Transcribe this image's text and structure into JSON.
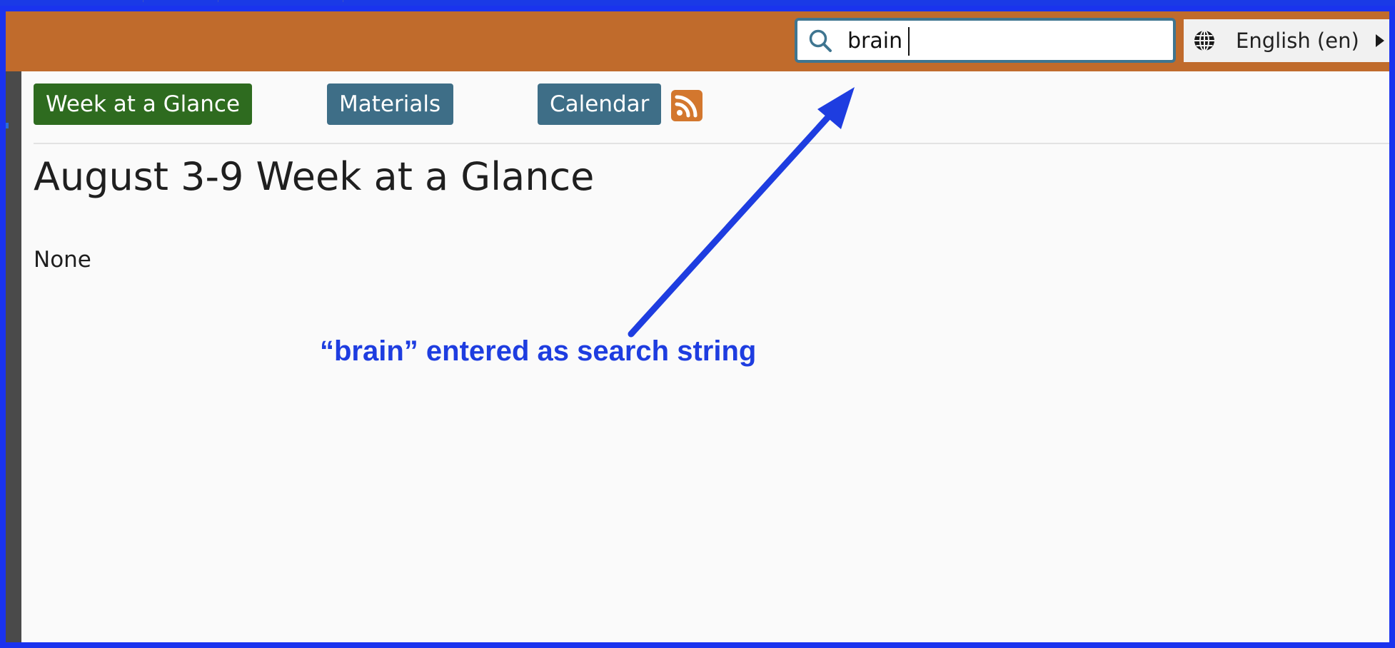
{
  "header": {
    "search": {
      "value": "brain",
      "icon": "search-icon"
    },
    "language": {
      "label": "English (en)",
      "icon": "globe-icon"
    }
  },
  "nav": {
    "week_label": "Week at a Glance",
    "materials_label": "Materials",
    "calendar_label": "Calendar",
    "rss_icon": "rss-icon"
  },
  "main": {
    "title": "August 3-9 Week at a Glance",
    "body_text": "None"
  },
  "annotation": {
    "text": "“brain” entered as search string"
  },
  "colors": {
    "header_orange": "#c06b2c",
    "frame_blue": "#1a33ee",
    "week_green": "#2e6b1f",
    "nav_teal": "#3e6e87",
    "rss_orange": "#d3772e",
    "annotation_blue": "#1e3de0"
  }
}
